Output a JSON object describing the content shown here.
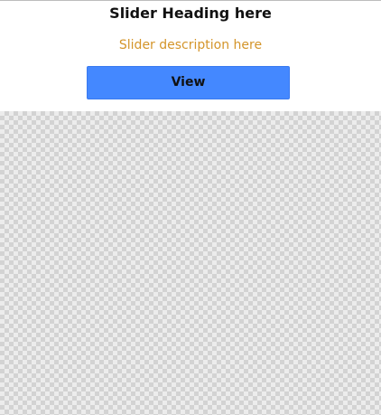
{
  "slide": {
    "heading": "Slider Heading here",
    "description": "Slider description here",
    "button_label": "View"
  },
  "colors": {
    "description_text": "#d4952a",
    "button_background": "#4488ff",
    "heading_text": "#111111"
  }
}
